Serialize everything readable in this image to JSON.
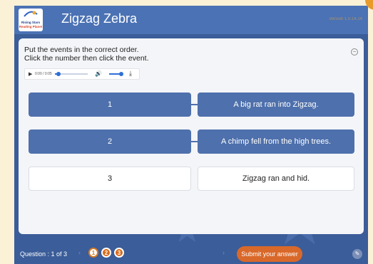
{
  "header": {
    "title": "Zigzag Zebra",
    "version": "Version 1.0.14.14",
    "logo": {
      "line1": "Rising Stars",
      "line2": "Reading Planet"
    }
  },
  "instructions": {
    "line1": "Put the events in the correct order.",
    "line2": "Click the number then click the event."
  },
  "audio": {
    "time": "0:00 / 0:05",
    "progress": 0.05
  },
  "rows": [
    {
      "number": "1",
      "event": "A big rat ran into Zigzag.",
      "matched": true
    },
    {
      "number": "2",
      "event": "A chimp fell from the high trees.",
      "matched": true
    },
    {
      "number": "3",
      "event": "Zigzag ran and hid.",
      "matched": false
    }
  ],
  "footer": {
    "question_label": "Question : 1 of 3",
    "pages": [
      "1",
      "2",
      "3"
    ],
    "current_page": "1",
    "submit_label": "Submit your answer"
  },
  "colors": {
    "background": "#3b5d99",
    "header": "#4b72b4",
    "matched_tile": "#4e70ac",
    "submit": "#d9692a"
  }
}
